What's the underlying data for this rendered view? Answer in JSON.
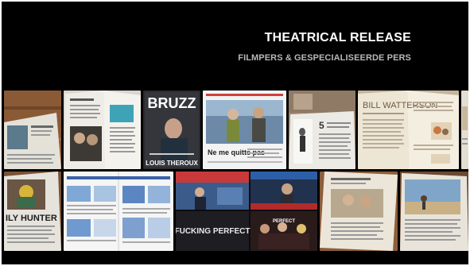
{
  "header": {
    "title": "THEATRICAL RELEASE",
    "subtitle": "FILMPERS & GESPECIALISEERDE PERS"
  },
  "clippings": {
    "bruzz_masthead": "BRUZZ",
    "bruzz_cover_line": "LOUIS THEROUX",
    "quote_headline": "Ne me quitte pas",
    "watterson_headline": "BILL WATTERSON",
    "hunter_headline": "ILY HUNTER",
    "tv_caption": "FUCKING PERFECT",
    "studio_caption": "PERFECT"
  },
  "colors": {
    "background": "#000000",
    "title": "#ffffff",
    "subtitle": "#b8b8b8",
    "wood": "#8a5a36",
    "paper": "#e9e4d9"
  }
}
